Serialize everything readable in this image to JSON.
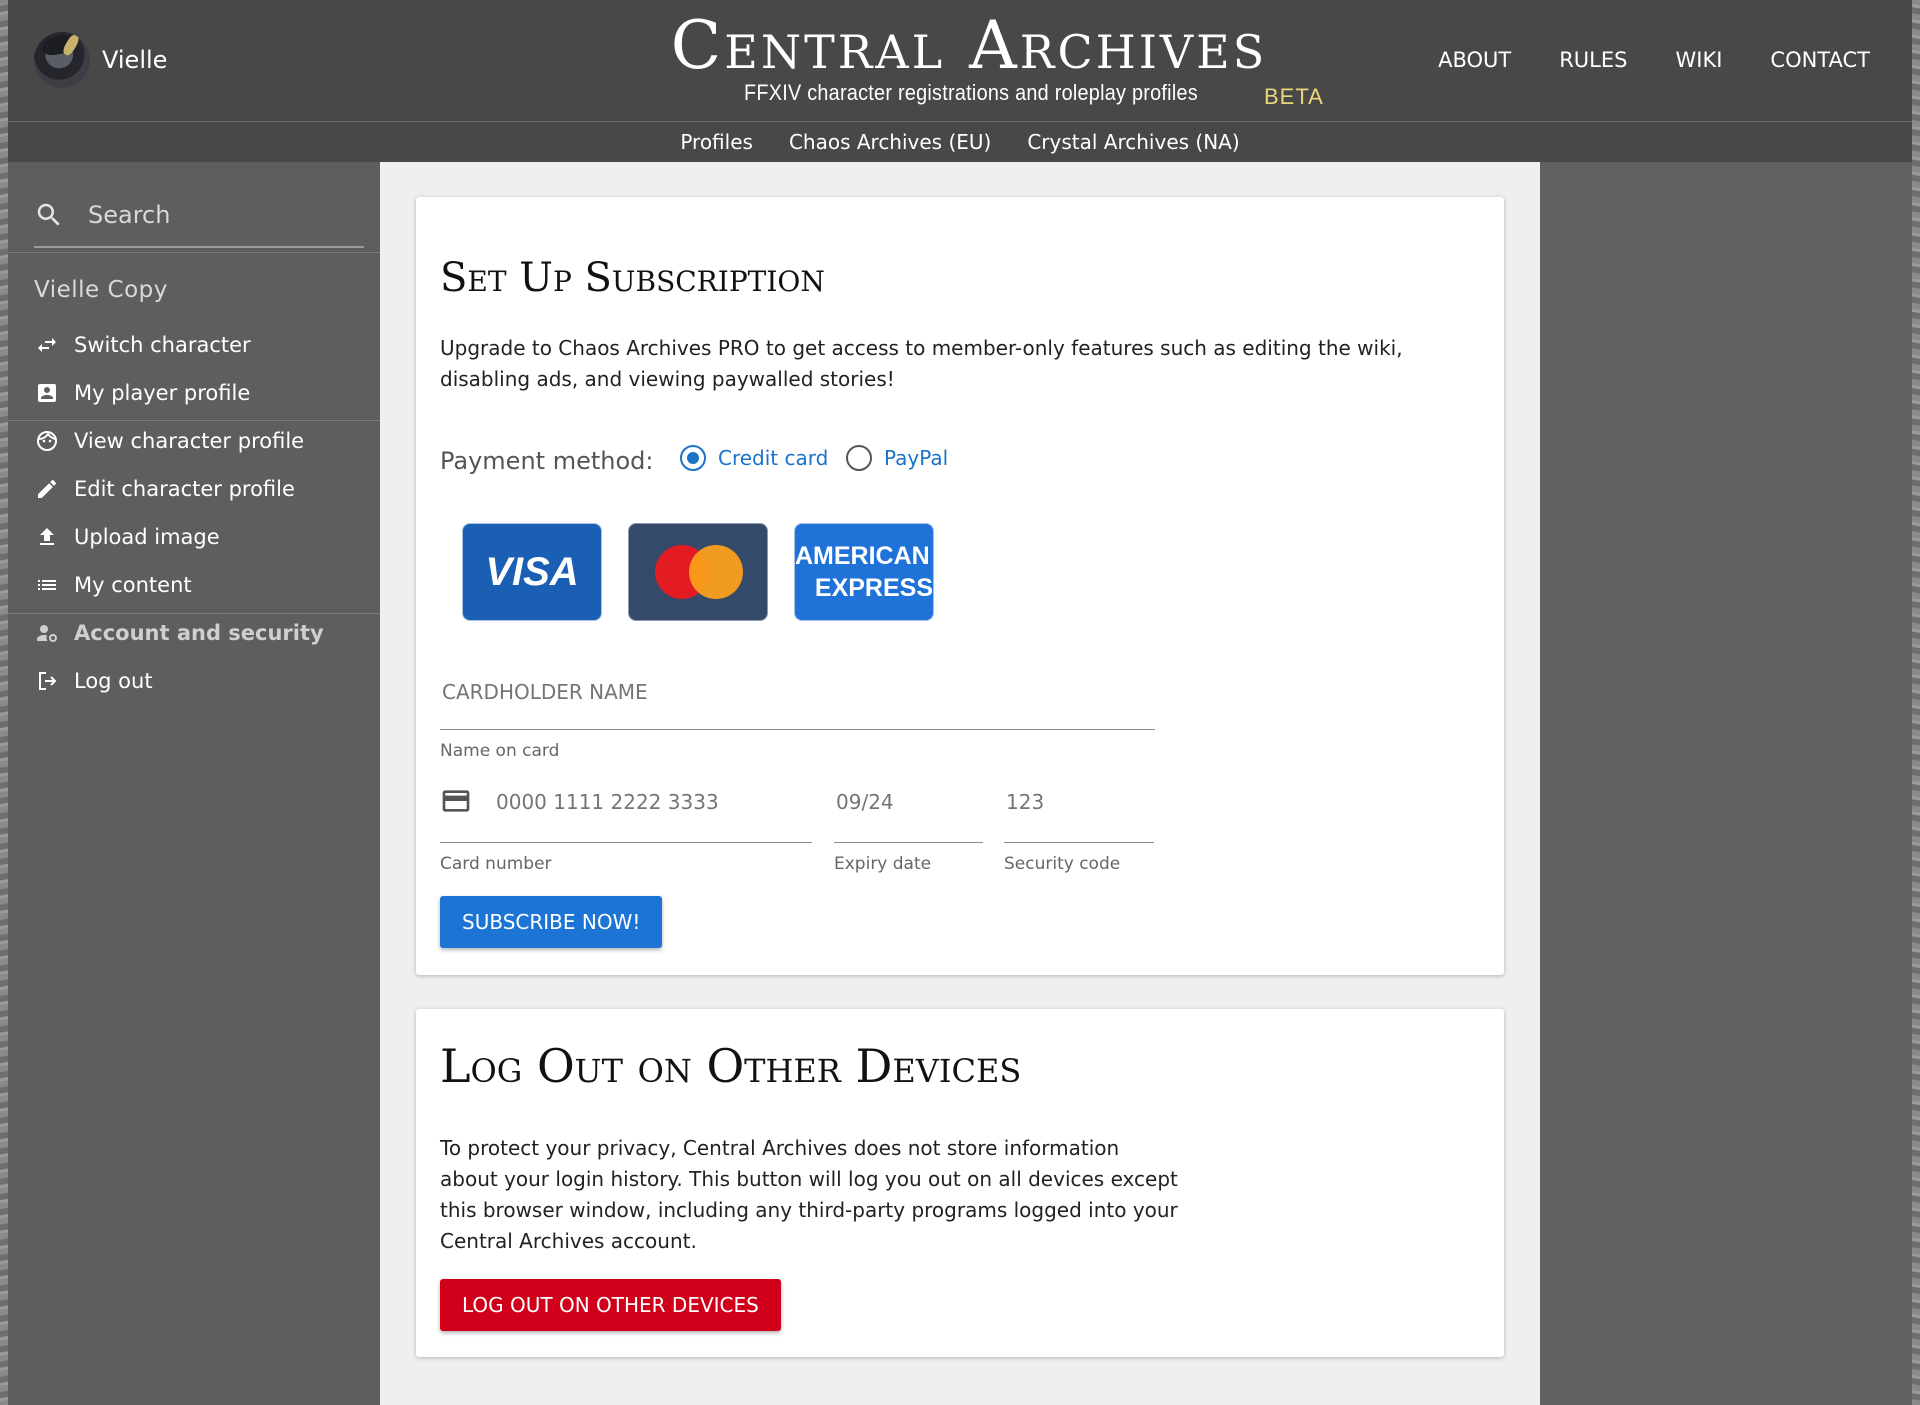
{
  "header": {
    "user_name": "Vielle",
    "site_title": "Central Archives",
    "site_subtitle": "FFXIV character registrations and roleplay profiles",
    "beta": "BETA",
    "nav": [
      "ABOUT",
      "RULES",
      "WIKI",
      "CONTACT"
    ]
  },
  "subnav": [
    "Profiles",
    "Chaos Archives (EU)",
    "Crystal Archives (NA)"
  ],
  "sidebar": {
    "search_placeholder": "Search",
    "character_name": "Vielle Copy",
    "items": [
      {
        "label": "Switch character",
        "icon": "swap-icon"
      },
      {
        "label": "My player profile",
        "icon": "account-box-icon"
      },
      {
        "label": "View character profile",
        "icon": "face-icon"
      },
      {
        "label": "Edit character profile",
        "icon": "pencil-icon"
      },
      {
        "label": "Upload image",
        "icon": "upload-icon"
      },
      {
        "label": "My content",
        "icon": "list-icon"
      },
      {
        "label": "Account and security",
        "icon": "account-cog-icon"
      },
      {
        "label": "Log out",
        "icon": "logout-icon"
      }
    ]
  },
  "subscription": {
    "title": "Set Up Subscription",
    "description": "Upgrade to Chaos Archives PRO to get access to member-only features such as editing the wiki, disabling ads, and viewing paywalled stories!",
    "payment_label": "Payment method:",
    "options": [
      "Credit card",
      "PayPal"
    ],
    "selected": "Credit card",
    "cards": {
      "visa": "VISA",
      "amex_line1": "AMERICAN",
      "amex_line2": "EXPRESS"
    },
    "cardholder_placeholder": "CARDHOLDER NAME",
    "cardholder_label": "Name on card",
    "card_number_placeholder": "0000 1111 2222 3333",
    "card_number_label": "Card number",
    "expiry_placeholder": "09/24",
    "expiry_label": "Expiry date",
    "cvc_placeholder": "123",
    "cvc_label": "Security code",
    "button": "SUBSCRIBE NOW!"
  },
  "logout_devices": {
    "title": "Log Out on Other Devices",
    "description": "To protect your privacy, Central Archives does not store information about your login history. This button will log you out on all devices except this browser window, including any third-party programs logged into your Central Archives account.",
    "button": "LOG OUT ON OTHER DEVICES"
  },
  "colors": {
    "primary": "#1c74d4",
    "danger": "#d0001a",
    "header": "#484848",
    "beta": "#e8d77a"
  }
}
